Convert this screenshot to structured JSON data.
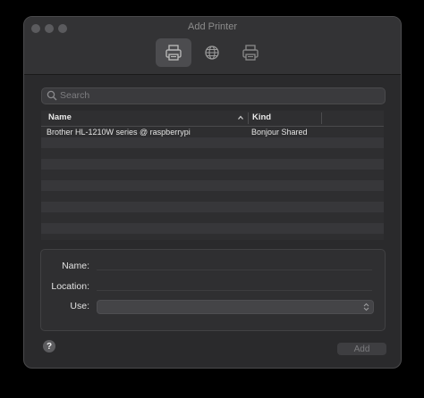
{
  "window": {
    "title": "Add Printer"
  },
  "toolbar": {
    "items": [
      {
        "icon": "printer-default-icon",
        "active": true
      },
      {
        "icon": "ip-globe-icon",
        "active": false
      },
      {
        "icon": "windows-printer-icon",
        "active": false
      }
    ]
  },
  "search": {
    "placeholder": "Search",
    "value": ""
  },
  "table": {
    "columns": [
      "Name",
      "Kind"
    ],
    "rows": [
      {
        "name": "Brother HL-1210W series @ raspberrypi",
        "kind": "Bonjour Shared"
      }
    ]
  },
  "details": {
    "name_label": "Name:",
    "location_label": "Location:",
    "use_label": "Use:",
    "use_value": ""
  },
  "footer": {
    "help_label": "?",
    "add_label": "Add"
  }
}
